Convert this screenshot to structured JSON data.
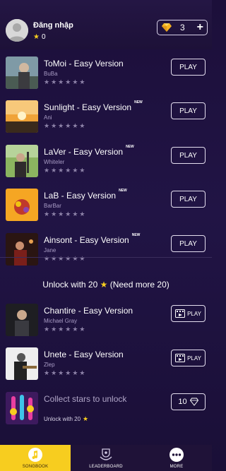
{
  "header": {
    "login_label": "Đăng nhập",
    "stars": "0",
    "gems": "3",
    "plus": "+"
  },
  "songs": [
    {
      "title": "ToMoi - Easy Version",
      "artist": "BuBa",
      "new": "",
      "button": "PLAY"
    },
    {
      "title": "Sunlight - Easy Version",
      "artist": "Ani",
      "new": "NEW",
      "button": "PLAY"
    },
    {
      "title": "LaVer - Easy Version",
      "artist": "Whiteler",
      "new": "NEW",
      "button": "PLAY"
    },
    {
      "title": "LaB - Easy Version",
      "artist": "BarBar",
      "new": "NEW",
      "button": "PLAY"
    },
    {
      "title": "Ainsont - Easy Version",
      "artist": "Jane",
      "new": "NEW",
      "button": "PLAY"
    }
  ],
  "unlock": {
    "prefix": "Unlock with 20",
    "suffix": "(Need more 20)"
  },
  "locked_songs": [
    {
      "title": "Chantire - Easy Version",
      "artist": "Michael Gray",
      "button": "PLAY"
    },
    {
      "title": "Unete - Easy Version",
      "artist": "Zlep",
      "button": "PLAY"
    }
  ],
  "collect": {
    "title": "Collect stars to unlock",
    "sub": "Unlock with 20",
    "price": "10"
  },
  "nav": [
    {
      "label": "SONGBOOK",
      "icon": "music-note-icon"
    },
    {
      "label": "LEADERBOARD",
      "icon": "trophy-badge-icon"
    },
    {
      "label": "MORE",
      "icon": "more-dots-icon"
    }
  ],
  "colors": {
    "accent": "#f7cd1f",
    "background": "#1c0f3a"
  }
}
